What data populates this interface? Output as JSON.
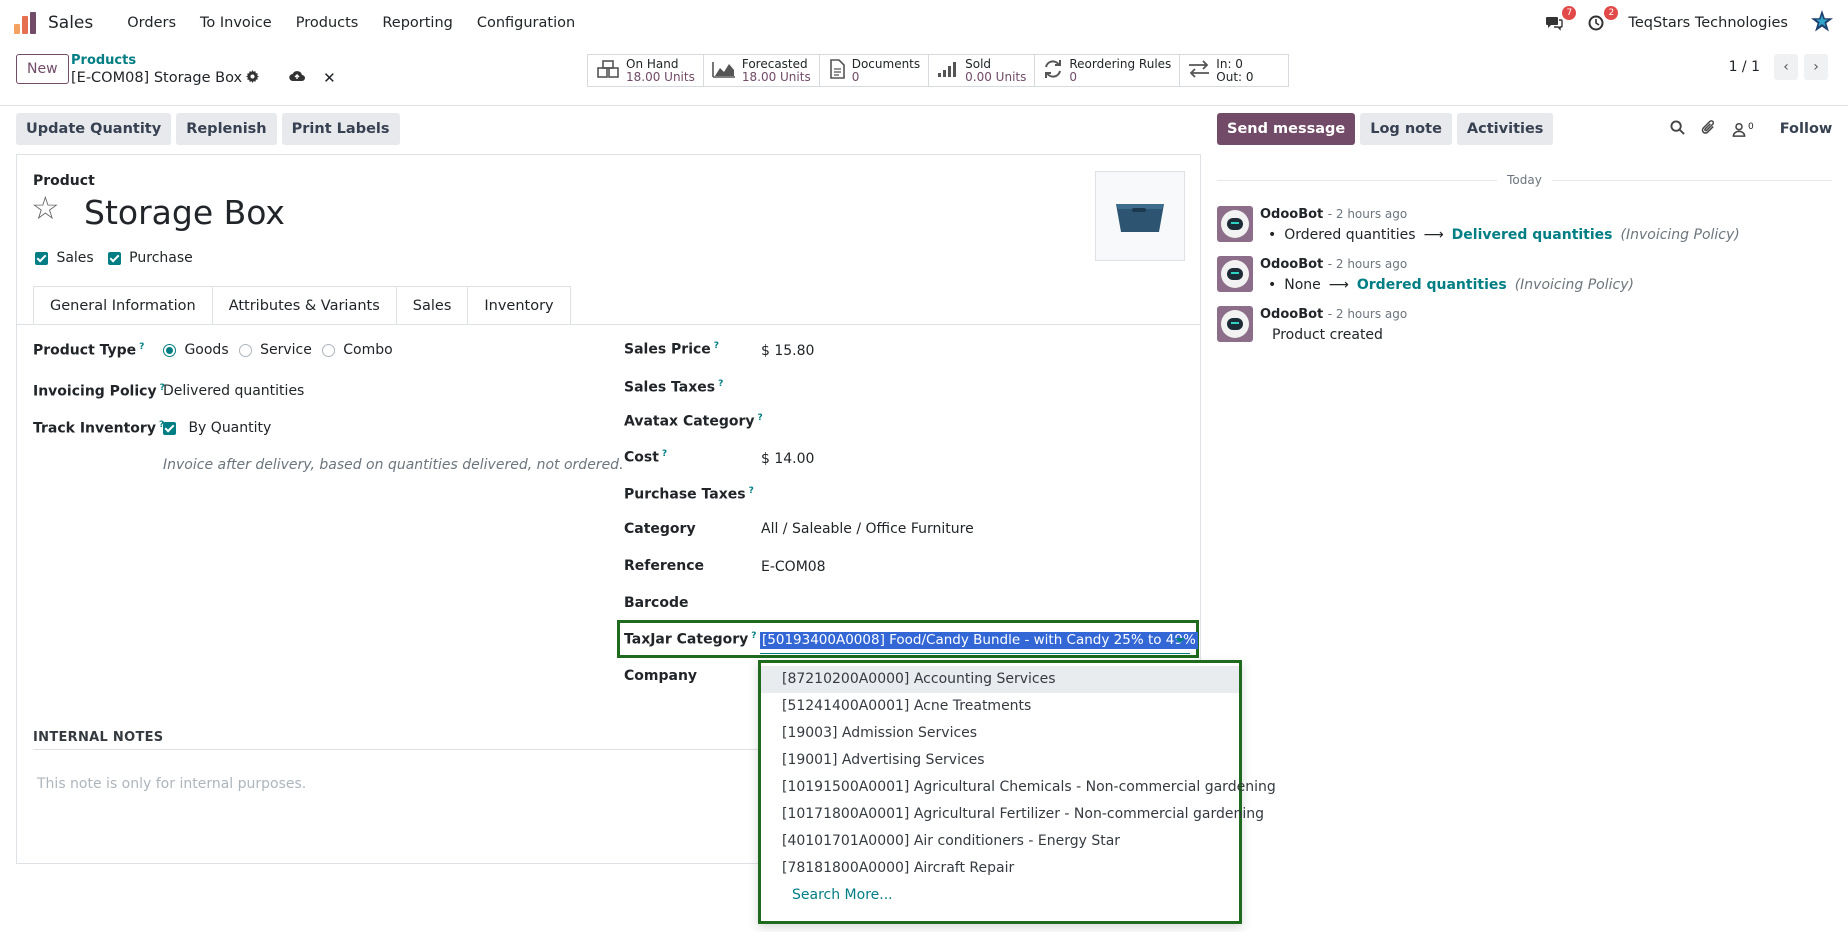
{
  "navbar": {
    "app_name": "Sales",
    "menu": [
      "Orders",
      "To Invoice",
      "Products",
      "Reporting",
      "Configuration"
    ],
    "messages_count": "7",
    "activities_count": "2",
    "company": "TeqStars Technologies"
  },
  "control": {
    "new_label": "New",
    "breadcrumb_parent": "Products",
    "record_name": "[E-COM08] Storage Box",
    "pager": "1 / 1"
  },
  "smart_buttons": [
    {
      "label": "On Hand",
      "value": "18.00 Units"
    },
    {
      "label": "Forecasted",
      "value": "18.00 Units"
    },
    {
      "label": "Documents",
      "value": "0"
    },
    {
      "label": "Sold",
      "value": "0.00 Units"
    },
    {
      "label": "Reordering Rules",
      "value": "0"
    },
    {
      "label": "In: 0",
      "value": "Out: 0"
    }
  ],
  "actions": [
    "Update Quantity",
    "Replenish",
    "Print Labels"
  ],
  "form": {
    "product_label": "Product",
    "name": "Storage Box",
    "sales_check": "Sales",
    "purchase_check": "Purchase",
    "tabs": [
      "General Information",
      "Attributes & Variants",
      "Sales",
      "Inventory"
    ],
    "product_type_label": "Product Type",
    "product_type_options": [
      "Goods",
      "Service",
      "Combo"
    ],
    "invoicing_policy_label": "Invoicing Policy",
    "invoicing_policy_value": "Delivered quantities",
    "track_inventory_label": "Track Inventory",
    "track_inventory_value": "By Quantity",
    "invoice_hint": "Invoice after delivery, based on quantities delivered, not ordered.",
    "sales_price_label": "Sales Price",
    "sales_price_value": "$ 15.80",
    "sales_taxes_label": "Sales Taxes",
    "avatax_label": "Avatax Category",
    "cost_label": "Cost",
    "cost_value": "$ 14.00",
    "purchase_taxes_label": "Purchase Taxes",
    "category_label": "Category",
    "category_value": "All / Saleable / Office Furniture",
    "reference_label": "Reference",
    "reference_value": "E-COM08",
    "barcode_label": "Barcode",
    "taxjar_label": "TaxJar Category",
    "taxjar_value": "[50193400A0008] Food/Candy Bundle - with Candy 25% to 49%",
    "company_label": "Company",
    "notes_heading": "INTERNAL NOTES",
    "notes_placeholder": "This note is only for internal purposes."
  },
  "dropdown": {
    "items": [
      "[87210200A0000] Accounting Services",
      "[51241400A0001] Acne Treatments",
      "[19003] Admission Services",
      "[19001] Advertising Services",
      "[10191500A0001] Agricultural Chemicals - Non-commercial gardening",
      "[10171800A0001] Agricultural Fertilizer - Non-commercial gardening",
      "[40101701A0000] Air conditioners - Energy Star",
      "[78181800A0000] Aircraft Repair"
    ],
    "search_more": "Search More..."
  },
  "chatter": {
    "send_message": "Send message",
    "log_note": "Log note",
    "activities": "Activities",
    "followers_count": "0",
    "follow": "Follow",
    "today": "Today",
    "messages": [
      {
        "author": "OdooBot",
        "time": "- 2 hours ago",
        "old": "Ordered quantities",
        "new": "Delivered quantities",
        "field": "(Invoicing Policy)"
      },
      {
        "author": "OdooBot",
        "time": "- 2 hours ago",
        "old": "None",
        "new": "Ordered quantities",
        "field": "(Invoicing Policy)"
      },
      {
        "author": "OdooBot",
        "time": "- 2 hours ago",
        "body": "Product created"
      }
    ]
  },
  "colors": {
    "brand": "#714b67",
    "accent": "#017e84",
    "highlight_border": "#1e6b1e",
    "selection": "#3367d6"
  }
}
